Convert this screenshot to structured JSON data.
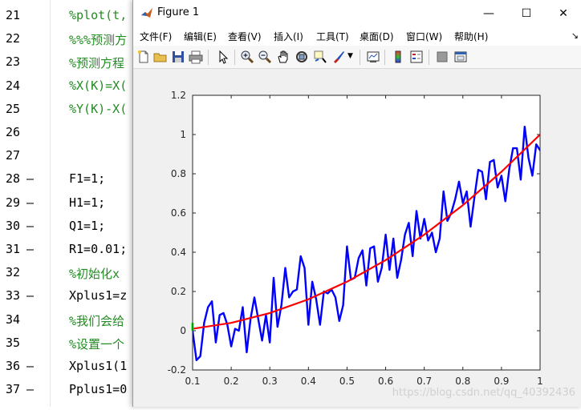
{
  "editor": {
    "lines": [
      {
        "num": "21",
        "dash": "",
        "text": "%plot(t,",
        "comment": true
      },
      {
        "num": "22",
        "dash": "",
        "text": "%%%预测方",
        "comment": true
      },
      {
        "num": "23",
        "dash": "",
        "text": "%预测方程",
        "comment": true
      },
      {
        "num": "24",
        "dash": "",
        "text": "%X(K)=X(",
        "comment": true
      },
      {
        "num": "25",
        "dash": "",
        "text": "%Y(K)-X(",
        "comment": true
      },
      {
        "num": "26",
        "dash": "",
        "text": "",
        "comment": false
      },
      {
        "num": "27",
        "dash": "",
        "text": "",
        "comment": false
      },
      {
        "num": "28",
        "dash": "—",
        "text": "F1=1;",
        "comment": false
      },
      {
        "num": "29",
        "dash": "—",
        "text": "H1=1;",
        "comment": false
      },
      {
        "num": "30",
        "dash": "—",
        "text": "Q1=1;",
        "comment": false
      },
      {
        "num": "31",
        "dash": "—",
        "text": "R1=0.01;",
        "comment": false
      },
      {
        "num": "32",
        "dash": "",
        "text": "%初始化x",
        "comment": true
      },
      {
        "num": "33",
        "dash": "—",
        "text": "Xplus1=z",
        "comment": false
      },
      {
        "num": "34",
        "dash": "",
        "text": "%我们会给",
        "comment": true
      },
      {
        "num": "35",
        "dash": "",
        "text": "%设置一个",
        "comment": true
      },
      {
        "num": "36",
        "dash": "—",
        "text": "Xplus1(1",
        "comment": false
      },
      {
        "num": "37",
        "dash": "—",
        "text": "Pplus1=0",
        "comment": false
      }
    ]
  },
  "figure": {
    "title": "Figure 1",
    "window_buttons": {
      "minimize": "—",
      "maximize": "☐",
      "close": "✕"
    },
    "menu": [
      "文件(F)",
      "编辑(E)",
      "查看(V)",
      "插入(I)",
      "工具(T)",
      "桌面(D)",
      "窗口(W)",
      "帮助(H)"
    ],
    "menu_overflow": "↘",
    "toolbar_icons": [
      "new-figure-icon",
      "open-icon",
      "save-icon",
      "print-icon",
      "pointer-icon",
      "zoom-in-icon",
      "zoom-out-icon",
      "pan-icon",
      "rotate-icon",
      "data-cursor-icon",
      "brush-icon",
      "brush-dropdown-icon",
      "link-plot-icon",
      "colorbar-icon",
      "legend-icon",
      "hide-plot-tools-icon",
      "show-plot-tools-icon"
    ],
    "colors": {
      "noisy": "#0000ff",
      "fit": "#ff0000",
      "marker": "#00ff00"
    }
  },
  "watermark": "https://blog.csdn.net/qq_40392436",
  "chart_data": {
    "type": "line",
    "title": "",
    "xlabel": "",
    "ylabel": "",
    "xlim": [
      0.1,
      1
    ],
    "ylim": [
      -0.2,
      1.2
    ],
    "xticks": [
      "0.1",
      "0.2",
      "0.3",
      "0.4",
      "0.5",
      "0.6",
      "0.7",
      "0.8",
      "0.9",
      "1"
    ],
    "yticks": [
      "-0.2",
      "0",
      "0.2",
      "0.4",
      "0.6",
      "0.8",
      "1",
      "1.2"
    ],
    "grid": false,
    "series": [
      {
        "color": "#0000ff",
        "points": [
          [
            0.1,
            0.0
          ],
          [
            0.11,
            -0.15
          ],
          [
            0.12,
            -0.13
          ],
          [
            0.13,
            0.04
          ],
          [
            0.14,
            0.12
          ],
          [
            0.15,
            0.15
          ],
          [
            0.16,
            -0.06
          ],
          [
            0.17,
            0.08
          ],
          [
            0.18,
            0.09
          ],
          [
            0.19,
            0.03
          ],
          [
            0.2,
            -0.08
          ],
          [
            0.21,
            0.01
          ],
          [
            0.22,
            0.0
          ],
          [
            0.23,
            0.12
          ],
          [
            0.24,
            -0.11
          ],
          [
            0.25,
            0.06
          ],
          [
            0.26,
            0.17
          ],
          [
            0.27,
            0.06
          ],
          [
            0.28,
            -0.05
          ],
          [
            0.29,
            0.08
          ],
          [
            0.3,
            -0.06
          ],
          [
            0.31,
            0.27
          ],
          [
            0.32,
            0.02
          ],
          [
            0.33,
            0.13
          ],
          [
            0.34,
            0.32
          ],
          [
            0.35,
            0.17
          ],
          [
            0.36,
            0.2
          ],
          [
            0.37,
            0.21
          ],
          [
            0.38,
            0.38
          ],
          [
            0.39,
            0.32
          ],
          [
            0.4,
            0.03
          ],
          [
            0.41,
            0.25
          ],
          [
            0.42,
            0.16
          ],
          [
            0.43,
            0.03
          ],
          [
            0.44,
            0.2
          ],
          [
            0.45,
            0.19
          ],
          [
            0.46,
            0.21
          ],
          [
            0.47,
            0.17
          ],
          [
            0.48,
            0.05
          ],
          [
            0.49,
            0.13
          ],
          [
            0.5,
            0.43
          ],
          [
            0.51,
            0.26
          ],
          [
            0.52,
            0.27
          ],
          [
            0.53,
            0.37
          ],
          [
            0.54,
            0.41
          ],
          [
            0.55,
            0.23
          ],
          [
            0.56,
            0.42
          ],
          [
            0.57,
            0.43
          ],
          [
            0.58,
            0.25
          ],
          [
            0.59,
            0.32
          ],
          [
            0.6,
            0.49
          ],
          [
            0.61,
            0.31
          ],
          [
            0.62,
            0.47
          ],
          [
            0.63,
            0.27
          ],
          [
            0.64,
            0.36
          ],
          [
            0.65,
            0.49
          ],
          [
            0.66,
            0.55
          ],
          [
            0.67,
            0.38
          ],
          [
            0.68,
            0.61
          ],
          [
            0.69,
            0.47
          ],
          [
            0.7,
            0.57
          ],
          [
            0.71,
            0.46
          ],
          [
            0.72,
            0.5
          ],
          [
            0.73,
            0.4
          ],
          [
            0.74,
            0.47
          ],
          [
            0.75,
            0.71
          ],
          [
            0.76,
            0.56
          ],
          [
            0.77,
            0.6
          ],
          [
            0.78,
            0.67
          ],
          [
            0.79,
            0.76
          ],
          [
            0.8,
            0.65
          ],
          [
            0.81,
            0.71
          ],
          [
            0.82,
            0.53
          ],
          [
            0.83,
            0.68
          ],
          [
            0.84,
            0.82
          ],
          [
            0.85,
            0.81
          ],
          [
            0.86,
            0.67
          ],
          [
            0.87,
            0.86
          ],
          [
            0.88,
            0.87
          ],
          [
            0.89,
            0.73
          ],
          [
            0.9,
            0.79
          ],
          [
            0.91,
            0.66
          ],
          [
            0.92,
            0.82
          ],
          [
            0.93,
            0.93
          ],
          [
            0.94,
            0.93
          ],
          [
            0.95,
            0.77
          ],
          [
            0.96,
            1.04
          ],
          [
            0.97,
            0.88
          ],
          [
            0.98,
            0.79
          ],
          [
            0.99,
            0.95
          ],
          [
            1.0,
            0.92
          ],
          [
            1.01,
            0.96
          ],
          [
            1.02,
            1.04
          ]
        ]
      },
      {
        "color": "#ff0000",
        "points": [
          [
            0.1,
            0.01
          ],
          [
            0.2,
            0.04
          ],
          [
            0.3,
            0.09
          ],
          [
            0.4,
            0.16
          ],
          [
            0.5,
            0.25
          ],
          [
            0.6,
            0.36
          ],
          [
            0.7,
            0.49
          ],
          [
            0.8,
            0.64
          ],
          [
            0.9,
            0.81
          ],
          [
            1.0,
            1.0
          ]
        ]
      }
    ],
    "marker": {
      "color": "#00ff00",
      "x": 0.1,
      "y1": 0.0,
      "y2": 0.04
    }
  }
}
